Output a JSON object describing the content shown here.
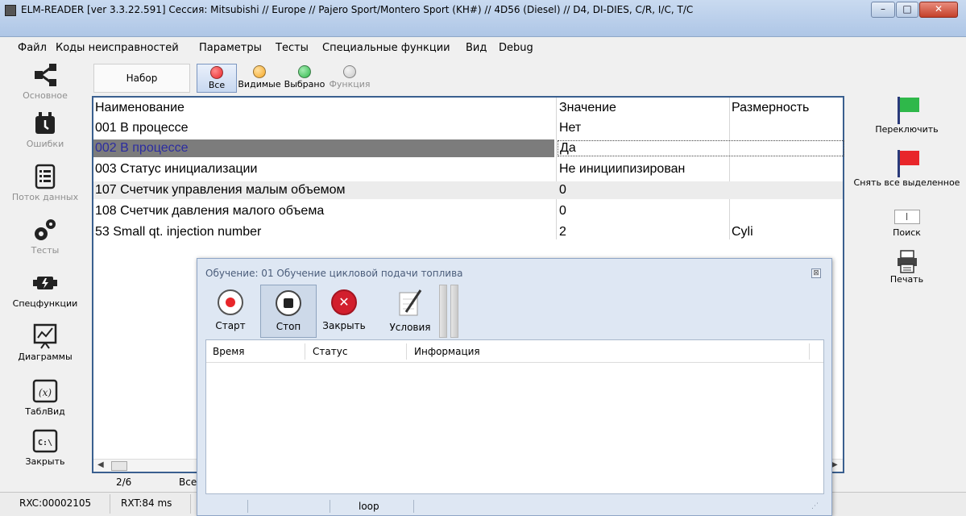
{
  "window": {
    "title": "ELM-READER [ver 3.3.22.591] Сессия: Mitsubishi // Europe // Pajero Sport/Montero Sport (KH#) // 4D56 (Diesel) // D4, DI-DIES, C/R, I/C, T/C",
    "minimize": "–",
    "maximize": "□",
    "close": "✕"
  },
  "menu": [
    "Файл",
    "Коды неисправностей",
    "Параметры",
    "Тесты",
    "Специальные функции",
    "Вид",
    "Debug"
  ],
  "sidebar": {
    "items": [
      {
        "label": "Основное",
        "icon": "share-nodes-icon",
        "enabled": false
      },
      {
        "label": "Ошибки",
        "icon": "bell-icon",
        "enabled": false
      },
      {
        "label": "Поток данных",
        "icon": "list-icon",
        "enabled": false
      },
      {
        "label": "Тесты",
        "icon": "gears-icon",
        "enabled": false
      },
      {
        "label": "Спецфункции",
        "icon": "engine-icon",
        "enabled": true
      },
      {
        "label": "Диаграммы",
        "icon": "chart-icon",
        "enabled": true
      },
      {
        "label": "ТаблВид",
        "icon": "formula-icon",
        "enabled": true
      },
      {
        "label": "Закрыть",
        "icon": "console-icon",
        "enabled": true
      }
    ]
  },
  "filterbar": {
    "set_label": "Набор",
    "all_label": "Все",
    "visible_label": "Видимые",
    "selected_label": "Выбрано",
    "function_label": "Функция",
    "colors": {
      "red": "#e8262a",
      "orange": "#f5a623",
      "green": "#2fb84a",
      "gray": "#c8c8c8"
    }
  },
  "table": {
    "headers": [
      "Наименование",
      "Значение",
      "Размерность"
    ],
    "rows": [
      {
        "name": "001 В процессе",
        "value": "Нет",
        "unit": ""
      },
      {
        "name": "002 В процессе",
        "value": "Да",
        "unit": "",
        "selected": true
      },
      {
        "name": "003 Статус инициализации",
        "value": "Не инициипизирован",
        "unit": ""
      },
      {
        "name": "107 Счетчик управления малым объемом",
        "value": "0",
        "unit": ""
      },
      {
        "name": "108 Счетчик давления малого объема",
        "value": "0",
        "unit": ""
      },
      {
        "name": "53 Small qt. injection number",
        "value": "2",
        "unit": "Cyli"
      }
    ]
  },
  "right_panel": {
    "toggle_label": "Переключить",
    "clear_label": "Снять все выделенное",
    "search_label": "Поиск",
    "search_glyph": "I",
    "print_label": "Печать"
  },
  "pager": {
    "page": "2/6",
    "truncated": "Все"
  },
  "statusbar": {
    "rxc": "RXC:00002105",
    "rxt": "RXT:84 ms"
  },
  "dialog": {
    "title": "Обучение: 01 Обучение цикловой подачи топлива",
    "close_glyph": "⊠",
    "buttons": {
      "start": "Старт",
      "stop": "Стоп",
      "close": "Закрыть",
      "conditions": "Условия"
    },
    "columns": [
      "Время",
      "Статус",
      "Информация"
    ],
    "status_text": "loop"
  }
}
